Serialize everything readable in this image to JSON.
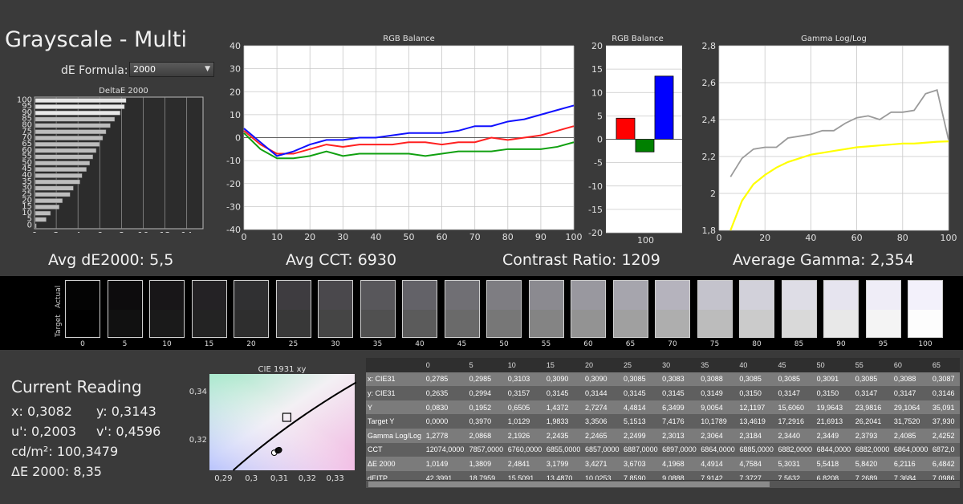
{
  "title": "Grayscale - Multi",
  "formula": {
    "label": "dE Formula:",
    "value": "2000"
  },
  "deltae_chart": {
    "title": "DeltaE 2000",
    "y_ticks": [
      "100",
      "95",
      "90",
      "85",
      "80",
      "75",
      "70",
      "65",
      "60",
      "55",
      "50",
      "45",
      "40",
      "35",
      "30",
      "25",
      "20",
      "15",
      "10",
      "5",
      "0"
    ],
    "y_tick_labels": [
      "100",
      "95",
      "90",
      "85",
      "80",
      "75",
      "70",
      "65",
      "60",
      "55",
      "50",
      "45",
      "40",
      "35",
      "30",
      "25",
      "20",
      "15",
      "10",
      "5",
      "0"
    ],
    "x_ticks": [
      "0",
      "2",
      "4",
      "6",
      "8",
      "10",
      "12",
      "14"
    ],
    "values": [
      8.35,
      8.2,
      7.8,
      7.3,
      6.9,
      6.5,
      6.2,
      5.9,
      5.6,
      5.3,
      5.0,
      4.7,
      4.3,
      4.1,
      3.5,
      3.2,
      2.5,
      2.2,
      1.4,
      1.0,
      0.1
    ]
  },
  "summary": {
    "avg_de": "Avg dE2000: 5,5",
    "avg_cct": "Avg CCT: 6930",
    "contrast": "Contrast Ratio: 1209",
    "avg_gamma": "Average Gamma: 2,354"
  },
  "chart_data": [
    {
      "type": "line",
      "title": "RGB Balance",
      "x": [
        0,
        5,
        10,
        15,
        20,
        25,
        30,
        35,
        40,
        45,
        50,
        55,
        60,
        65,
        70,
        75,
        80,
        85,
        90,
        95,
        100
      ],
      "ylim": [
        -40,
        40
      ],
      "xlim": [
        0,
        100
      ],
      "x_ticks": [
        "0",
        "10",
        "20",
        "30",
        "40",
        "50",
        "60",
        "70",
        "80",
        "90",
        "100"
      ],
      "y_ticks": [
        "40",
        "30",
        "20",
        "10",
        "0",
        "-10",
        "-20",
        "-30",
        "-40"
      ],
      "series": [
        {
          "color": "#ff2020",
          "values": [
            3,
            -3,
            -7,
            -7,
            -5,
            -3,
            -4,
            -3,
            -3,
            -3,
            -2,
            -2,
            -3,
            -2,
            -2,
            0,
            -1,
            0,
            1,
            3,
            5
          ]
        },
        {
          "color": "#1010ff",
          "values": [
            4,
            -2,
            -8,
            -6,
            -3,
            -1,
            -1,
            0,
            0,
            1,
            2,
            2,
            2,
            3,
            5,
            5,
            7,
            8,
            10,
            12,
            14
          ]
        },
        {
          "color": "#10a010",
          "values": [
            2,
            -5,
            -9,
            -9,
            -8,
            -6,
            -8,
            -7,
            -7,
            -7,
            -7,
            -8,
            -7,
            -6,
            -6,
            -6,
            -5,
            -5,
            -5,
            -4,
            -2
          ]
        }
      ]
    },
    {
      "type": "bar",
      "title": "RGB Balance",
      "categories": [
        "100"
      ],
      "ylim": [
        -20,
        20
      ],
      "y_ticks": [
        "20",
        "15",
        "10",
        "5",
        "0",
        "-5",
        "-10",
        "-15",
        "-20"
      ],
      "series": [
        {
          "color": "#ff0000",
          "value": 4.5
        },
        {
          "color": "#008000",
          "value": -2.7
        },
        {
          "color": "#0000ff",
          "value": 13.5
        }
      ]
    },
    {
      "type": "line",
      "title": "Gamma Log/Log",
      "x": [
        5,
        10,
        15,
        20,
        25,
        30,
        35,
        40,
        45,
        50,
        55,
        60,
        65,
        70,
        75,
        80,
        85,
        90,
        95,
        100
      ],
      "xlim": [
        0,
        100
      ],
      "ylim": [
        1.8,
        2.8
      ],
      "x_ticks": [
        "0",
        "20",
        "40",
        "60",
        "80",
        "100"
      ],
      "y_ticks": [
        "2,8",
        "2,6",
        "2,4",
        "2,2",
        "2",
        "1,8"
      ],
      "series": [
        {
          "color": "#9a9a9a",
          "values": [
            2.09,
            2.19,
            2.24,
            2.25,
            2.25,
            2.3,
            2.31,
            2.32,
            2.34,
            2.34,
            2.38,
            2.41,
            2.42,
            2.4,
            2.44,
            2.44,
            2.45,
            2.54,
            2.56,
            2.29
          ]
        },
        {
          "color": "#ffff00",
          "values": [
            1.8,
            1.96,
            2.05,
            2.1,
            2.14,
            2.17,
            2.19,
            2.21,
            2.22,
            2.23,
            2.24,
            2.25,
            2.255,
            2.26,
            2.265,
            2.27,
            2.27,
            2.275,
            2.28,
            2.282
          ]
        }
      ]
    },
    {
      "type": "scatter",
      "title": "CIE 1931 xy",
      "xlim": [
        0.285,
        0.337
      ],
      "ylim": [
        0.307,
        0.347
      ],
      "x_ticks": [
        "0,29",
        "0,3",
        "0,31",
        "0,32",
        "0,33"
      ],
      "y_ticks": [
        "0,34",
        "0,32"
      ],
      "target": [
        0.3127,
        0.329
      ],
      "readings": [
        [
          0.3082,
          0.3143
        ],
        [
          0.3095,
          0.3152
        ],
        [
          0.3099,
          0.3154
        ]
      ]
    }
  ],
  "strip": {
    "actual_label": "Actual",
    "target_label": "Target",
    "labels": [
      "0",
      "5",
      "10",
      "15",
      "20",
      "25",
      "30",
      "35",
      "40",
      "45",
      "50",
      "55",
      "60",
      "65",
      "70",
      "75",
      "80",
      "85",
      "90",
      "95",
      "100"
    ],
    "actual_colors": [
      "#040404",
      "#0d0c0d",
      "#181618",
      "#242225",
      "#303032",
      "#3e3c40",
      "#4a484c",
      "#58575b",
      "#636268",
      "#706f74",
      "#7e7d82",
      "#8b8a90",
      "#99989f",
      "#a6a5ad",
      "#b5b3bd",
      "#c4c3cc",
      "#d2d1da",
      "#dedde6",
      "#e6e4ef",
      "#efedf7",
      "#f3f1fb"
    ],
    "target_colors": [
      "#000000",
      "#111111",
      "#1a1a1a",
      "#232323",
      "#2e2e2e",
      "#383838",
      "#454545",
      "#505050",
      "#5b5b5b",
      "#6a6a6a",
      "#777777",
      "#848484",
      "#939393",
      "#a0a0a0",
      "#aeaeae",
      "#bcbcbc",
      "#cbcbcb",
      "#d9d9d9",
      "#e8e8e8",
      "#f4f4f4",
      "#fdfdfd"
    ]
  },
  "current_reading": {
    "title": "Current Reading",
    "x": "x: 0,3082",
    "y": "y: 0,3143",
    "u": "u': 0,2003",
    "v": "v': 0,4596",
    "cdm2": "cd/m²: 100,3479",
    "de": "ΔE 2000: 8,35"
  },
  "table": {
    "headers": [
      "",
      "0",
      "5",
      "10",
      "15",
      "20",
      "25",
      "30",
      "35",
      "40",
      "45",
      "50",
      "55",
      "60",
      "65"
    ],
    "rows": [
      [
        "x: CIE31",
        "0,2785",
        "0,2985",
        "0,3103",
        "0,3090",
        "0,3090",
        "0,3085",
        "0,3083",
        "0,3088",
        "0,3085",
        "0,3085",
        "0,3091",
        "0,3085",
        "0,3088",
        "0,3087"
      ],
      [
        "y: CIE31",
        "0,2635",
        "0,2994",
        "0,3157",
        "0,3145",
        "0,3144",
        "0,3145",
        "0,3145",
        "0,3149",
        "0,3150",
        "0,3147",
        "0,3150",
        "0,3147",
        "0,3147",
        "0,3146"
      ],
      [
        "Y",
        "0,0830",
        "0,1952",
        "0,6505",
        "1,4372",
        "2,7274",
        "4,4814",
        "6,3499",
        "9,0054",
        "12,1197",
        "15,6060",
        "19,9643",
        "23,9816",
        "29,1064",
        "35,091"
      ],
      [
        "Target Y",
        "0,0000",
        "0,3970",
        "1,0129",
        "1,9833",
        "3,3506",
        "5,1513",
        "7,4176",
        "10,1789",
        "13,4619",
        "17,2916",
        "21,6913",
        "26,2041",
        "31,7520",
        "37,930"
      ],
      [
        "Gamma Log/Log",
        "1,2778",
        "2,0868",
        "2,1926",
        "2,2435",
        "2,2465",
        "2,2499",
        "2,3013",
        "2,3064",
        "2,3184",
        "2,3440",
        "2,3449",
        "2,3793",
        "2,4085",
        "2,4252"
      ],
      [
        "CCT",
        "12074,0000",
        "7857,0000",
        "6760,0000",
        "6855,0000",
        "6857,0000",
        "6887,0000",
        "6897,0000",
        "6864,0000",
        "6885,0000",
        "6882,0000",
        "6844,0000",
        "6882,0000",
        "6864,0000",
        "6872,0"
      ],
      [
        "ΔE 2000",
        "1,0149",
        "1,3809",
        "2,4841",
        "3,1799",
        "3,4271",
        "3,6703",
        "4,1968",
        "4,4914",
        "4,7584",
        "5,3031",
        "5,5418",
        "5,8420",
        "6,2116",
        "6,4842"
      ],
      [
        "dEITP",
        "42,3991",
        "18,7959",
        "15,5091",
        "13,4870",
        "10,0253",
        "7,8590",
        "9,0888",
        "7,9142",
        "7,3727",
        "7,5632",
        "6,8208",
        "7,2689",
        "7,3684",
        "7,0986"
      ]
    ]
  }
}
